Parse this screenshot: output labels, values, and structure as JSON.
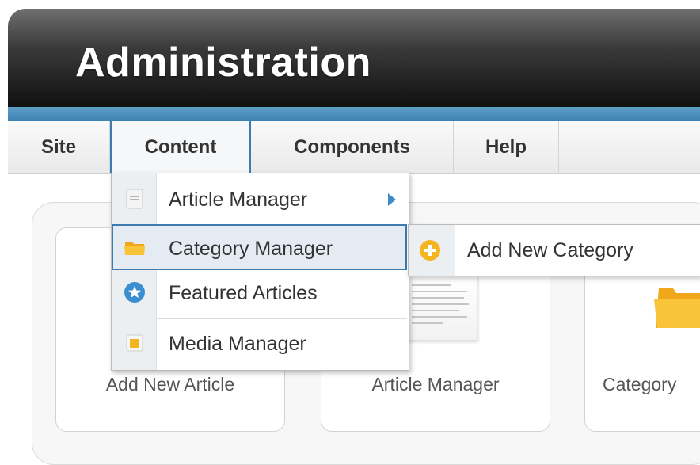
{
  "header": {
    "title": "Administration"
  },
  "menubar": {
    "items": [
      {
        "label": "Site"
      },
      {
        "label": "Content"
      },
      {
        "label": "Components"
      },
      {
        "label": "Help"
      }
    ]
  },
  "dropdown": {
    "items": [
      {
        "label": "Article Manager",
        "icon": "document-icon",
        "has_submenu": true
      },
      {
        "label": "Category Manager",
        "icon": "folder-icon"
      },
      {
        "label": "Featured Articles",
        "icon": "star-icon"
      },
      {
        "label": "Media Manager",
        "icon": "media-icon"
      }
    ]
  },
  "submenu": {
    "items": [
      {
        "label": "Add New Category",
        "icon": "plus-circle-icon"
      }
    ]
  },
  "cards": [
    {
      "label": "Add New Article"
    },
    {
      "label": "Article Manager"
    },
    {
      "label": "Category"
    }
  ],
  "colors": {
    "accent": "#3d7bb0",
    "header_dark": "#101010",
    "folder": "#f5b521"
  }
}
